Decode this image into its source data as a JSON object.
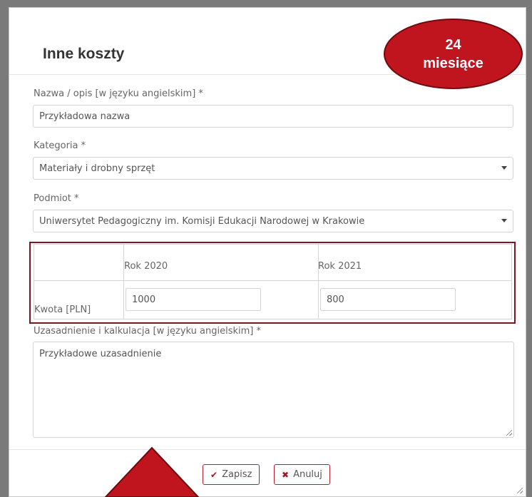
{
  "modal": {
    "title": "Inne koszty",
    "name_field": {
      "label": "Nazwa / opis [w języku angielskim] *",
      "value": "Przykładowa nazwa"
    },
    "category_field": {
      "label": "Kategoria *",
      "value": "Materiały i drobny sprzęt"
    },
    "entity_field": {
      "label": "Podmiot *",
      "value": "Uniwersytet Pedagogiczny im. Komisji Edukacji Narodowej w Krakowie"
    },
    "years_table": {
      "headers": [
        "Rok 2020",
        "Rok 2021"
      ],
      "row_label": "Kwota [PLN]",
      "values": [
        "1000",
        "800"
      ]
    },
    "justification_field": {
      "label": "Uzasadnienie i kalkulacja [w języku angielskim] *",
      "value": "Przykładowe uzasadnienie"
    },
    "buttons": {
      "save": "Zapisz",
      "cancel": "Anuluj"
    }
  },
  "annotation": {
    "badge_line1": "24",
    "badge_line2": "miesiące"
  },
  "colors": {
    "accent": "#b11f2a",
    "badge": "#c0151e",
    "highlight_border": "#7a1720"
  }
}
